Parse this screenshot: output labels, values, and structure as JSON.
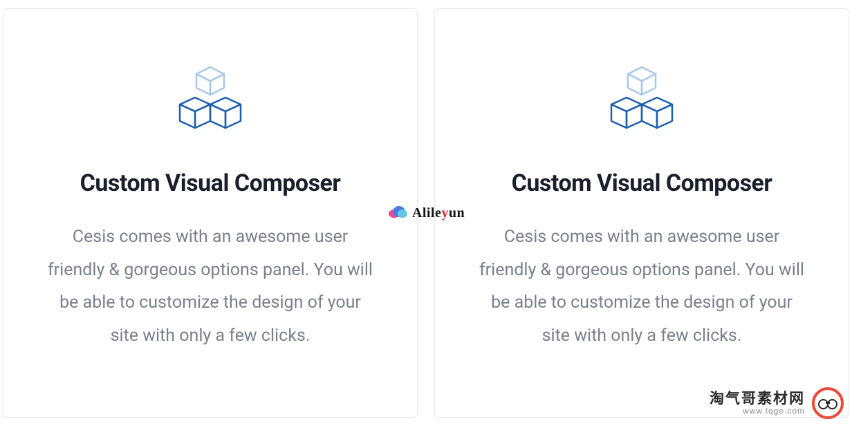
{
  "cards": [
    {
      "title": "Custom Visual Composer",
      "description": "Cesis comes with an awesome user friendly & gorgeous options panel. You will be able to customize the design of your site with only a few clicks."
    },
    {
      "title": "Custom Visual Composer",
      "description": "Cesis comes with an awesome user friendly & gorgeous options panel. You will be able to customize the design of your site with only a few clicks."
    }
  ],
  "watermark_center": {
    "brand_prefix": "Alile",
    "brand_accent": "y",
    "brand_suffix": "un"
  },
  "watermark_br": {
    "line1": "淘气哥素材网",
    "line2": "www.tqge.com"
  },
  "colors": {
    "icon_top_stroke": "#a8c9e8",
    "icon_bottom_stroke": "#1f5fb0",
    "border": "#e6e8ec",
    "title": "#1a1f2b",
    "desc": "#7a7f8c",
    "accent_red": "#e94b3c"
  }
}
